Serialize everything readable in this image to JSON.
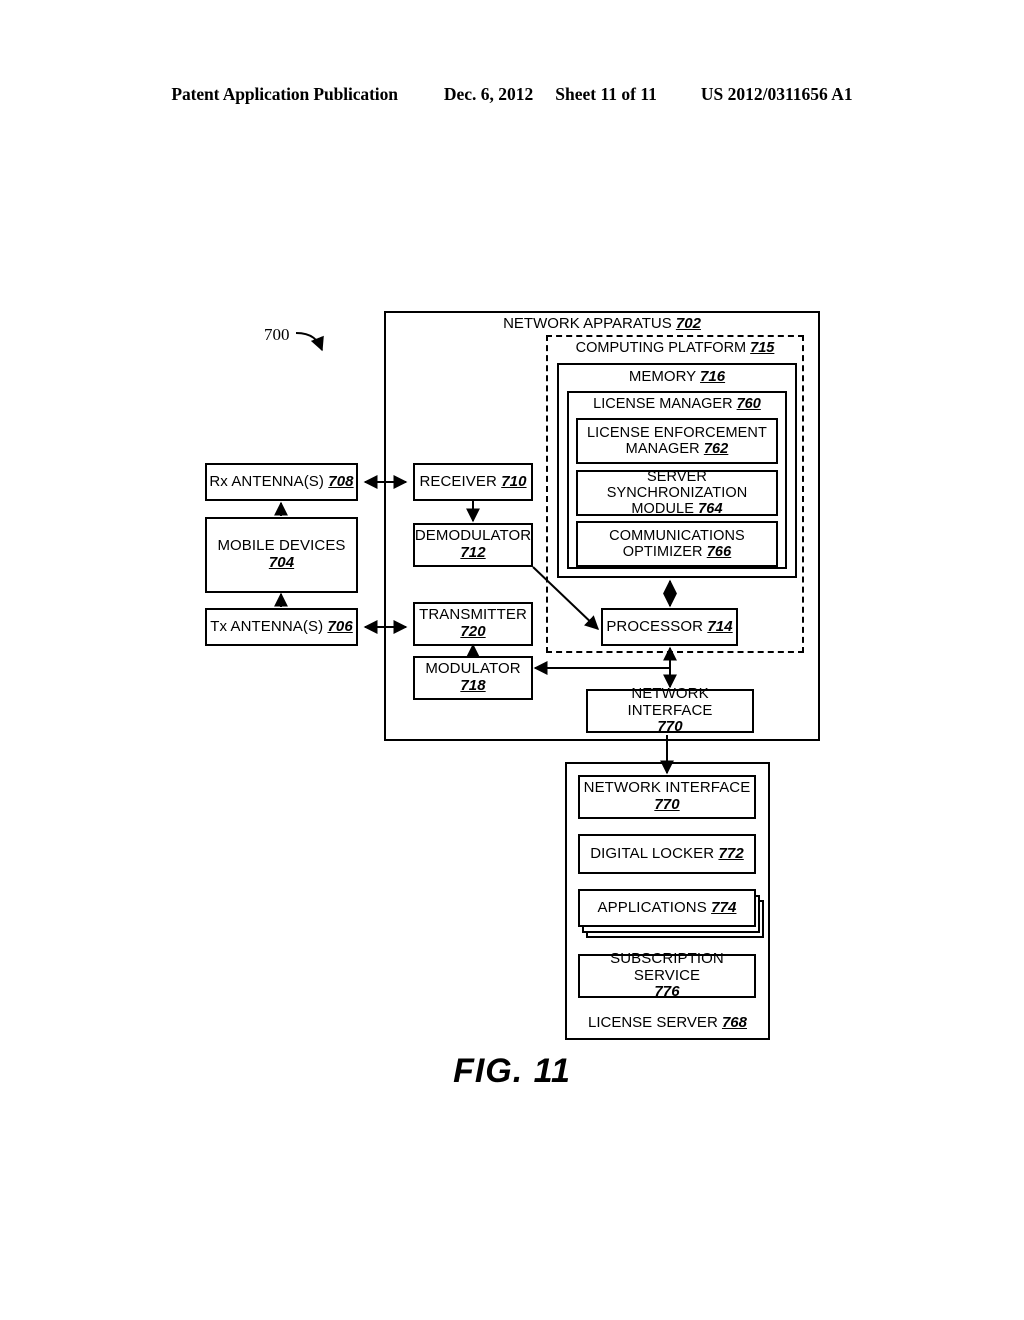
{
  "header": {
    "publication": "Patent Application Publication",
    "date": "Dec. 6, 2012",
    "sheet": "Sheet 11 of 11",
    "docnum": "US 2012/0311656 A1"
  },
  "figure": {
    "caption": "FIG. 11",
    "system_ref": "700"
  },
  "blocks": {
    "network_apparatus": {
      "label": "NETWORK APPARATUS",
      "num": "702"
    },
    "computing_platform": {
      "label": "COMPUTING PLATFORM",
      "num": "715"
    },
    "memory": {
      "label": "MEMORY",
      "num": "716"
    },
    "license_manager": {
      "label": "LICENSE MANAGER",
      "num": "760"
    },
    "license_enforcement_manager": {
      "label": "LICENSE ENFORCEMENT MANAGER",
      "num": "762"
    },
    "server_synchronization_module": {
      "label": "SERVER SYNCHRONIZATION MODULE",
      "num": "764"
    },
    "communications_optimizer": {
      "label": "COMMUNICATIONS OPTIMIZER",
      "num": "766"
    },
    "processor": {
      "label": "PROCESSOR",
      "num": "714"
    },
    "rx_antennas": {
      "label": "Rx ANTENNA(S)",
      "num": "708"
    },
    "tx_antennas": {
      "label": "Tx ANTENNA(S)",
      "num": "706"
    },
    "mobile_devices": {
      "label": "MOBILE DEVICES",
      "num": "704"
    },
    "receiver": {
      "label": "RECEIVER",
      "num": "710"
    },
    "demodulator": {
      "label": "DEMODULATOR",
      "num": "712"
    },
    "transmitter": {
      "label": "TRANSMITTER",
      "num": "720"
    },
    "modulator": {
      "label": "MODULATOR",
      "num": "718"
    },
    "network_interface_apparatus": {
      "label": "NETWORK INTERFACE",
      "num": "770"
    },
    "network_interface_server": {
      "label": "NETWORK INTERFACE",
      "num": "770"
    },
    "digital_locker": {
      "label": "DIGITAL LOCKER",
      "num": "772"
    },
    "applications": {
      "label": "APPLICATIONS",
      "num": "774"
    },
    "subscription_service": {
      "label": "SUBSCRIPTION SERVICE",
      "num": "776"
    },
    "license_server": {
      "label": "LICENSE SERVER",
      "num": "768"
    }
  }
}
